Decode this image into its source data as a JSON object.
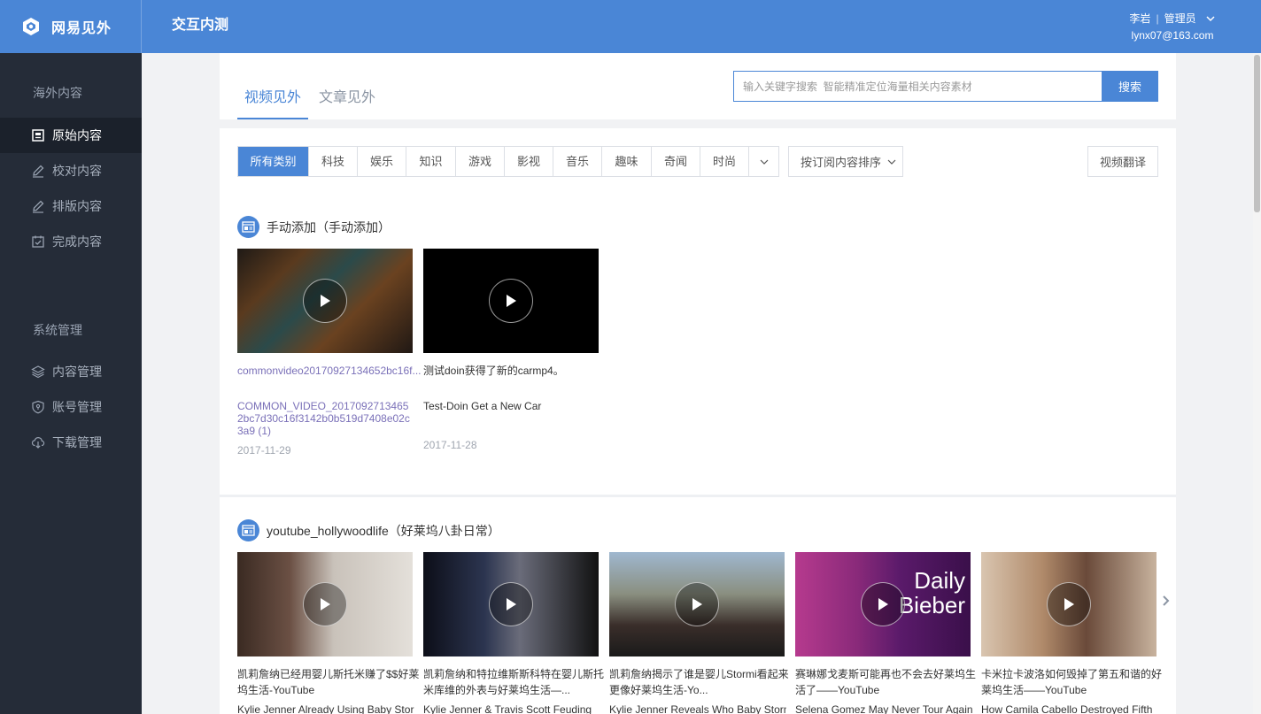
{
  "header": {
    "brand": "网易见外",
    "title": "交互内测",
    "user_name": "李岩",
    "user_role": "管理员",
    "user_email": "lynx07@163.com"
  },
  "sidebar": {
    "section1": "海外内容",
    "items1": [
      {
        "label": "原始内容",
        "icon": "document-icon",
        "active": true
      },
      {
        "label": "校对内容",
        "icon": "pencil-icon"
      },
      {
        "label": "排版内容",
        "icon": "pencil-icon"
      },
      {
        "label": "完成内容",
        "icon": "calendar-check-icon"
      }
    ],
    "section2": "系统管理",
    "items2": [
      {
        "label": "内容管理",
        "icon": "layers-icon"
      },
      {
        "label": "账号管理",
        "icon": "shield-icon"
      },
      {
        "label": "下载管理",
        "icon": "cloud-download-icon"
      }
    ]
  },
  "tabs": [
    {
      "label": "视频见外",
      "active": true
    },
    {
      "label": "文章见外",
      "active": false
    }
  ],
  "search": {
    "placeholder": "输入关键字搜索  智能精准定位海量相关内容素材",
    "button": "搜索"
  },
  "filters": {
    "categories": [
      "所有类别",
      "科技",
      "娱乐",
      "知识",
      "游戏",
      "影视",
      "音乐",
      "趣味",
      "奇闻",
      "时尚"
    ],
    "active": "所有类别",
    "sort_label": "按订阅内容排序",
    "translate_button": "视频翻译"
  },
  "sections": [
    {
      "title": "手动添加（手动添加）",
      "videos": [
        {
          "title": "commonvideo20170927134652bc16f...",
          "subtitle": "COMMON_VIDEO_20170927134652bc7d30c16f3142b0b519d7408e02c3a9 (1)",
          "date": "2017-11-29"
        },
        {
          "title": "测试doin获得了新的carmp4。",
          "subtitle": "Test-Doin Get a New Car",
          "date": "2017-11-28"
        }
      ]
    },
    {
      "title": "youtube_hollywoodlife（好莱坞八卦日常）",
      "videos": [
        {
          "title": "凯莉詹纳已经用婴儿斯托米赚了$$好莱坞生活-YouTube",
          "subtitle": "Kylie Jenner Already Using Baby Stormi"
        },
        {
          "title": "凯莉詹纳和特拉维斯斯科特在婴儿斯托米库维的外表与好莱坞生活—...",
          "subtitle": "Kylie Jenner & Travis Scott Feuding"
        },
        {
          "title": "凯莉詹纳揭示了谁是婴儿Stormi看起来更像好莱坞生活-Yo...",
          "subtitle": "Kylie Jenner Reveals Who Baby Stormi"
        },
        {
          "title": "赛琳娜戈麦斯可能再也不会去好莱坞生活了——YouTube",
          "subtitle": "Selena Gomez May Never Tour Again"
        },
        {
          "title": "卡米拉卡波洛如何毁掉了第五和谐的好莱坞生活——YouTube",
          "subtitle": "How Camila Cabello Destroyed Fifth"
        }
      ]
    }
  ],
  "thumb_overlay_text": [
    "Daily",
    "Bieber"
  ],
  "colors": {
    "primary": "#4a86d6",
    "sidebar_bg": "#252c38",
    "sidebar_active": "#1b212b",
    "link_purple": "#7a70b8"
  }
}
